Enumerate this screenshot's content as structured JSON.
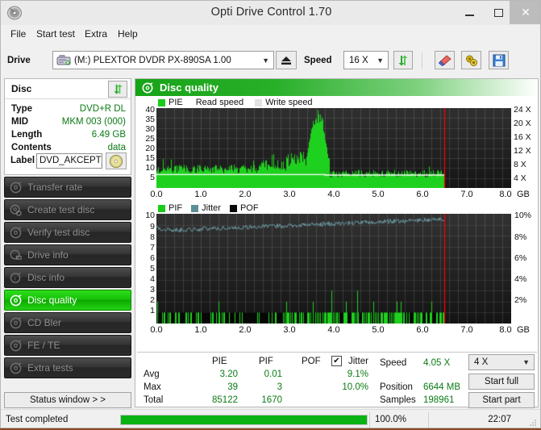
{
  "window": {
    "title": "Opti Drive Control 1.70",
    "icon": "disc-icon",
    "minimize": "–",
    "maximize": "□",
    "close": "✕"
  },
  "menu": {
    "items": [
      {
        "label": "File"
      },
      {
        "label": "Start test"
      },
      {
        "label": "Extra"
      },
      {
        "label": "Help"
      }
    ]
  },
  "toolbar": {
    "drive_label": "Drive",
    "drive_value": "(M:)   PLEXTOR DVDR   PX-890SA 1.00",
    "eject_icon": "eject-icon",
    "speed_label": "Speed",
    "speed_value": "16 X",
    "refresh_icon": "refresh-icon",
    "erase_icon": "eraser-icon",
    "settings_icon": "gear-icon",
    "save_icon": "save-icon"
  },
  "disc_panel": {
    "title": "Disc",
    "refresh_icon": "refresh-icon",
    "rows": [
      {
        "key": "Type",
        "value": "DVD+R DL"
      },
      {
        "key": "MID",
        "value": "MKM 003 (000)"
      },
      {
        "key": "Length",
        "value": "6.49 GB"
      },
      {
        "key": "Contents",
        "value": "data"
      }
    ],
    "label_key": "Label",
    "label_value": "DVD_AKCEPT_V",
    "label_icon": "cd-icon"
  },
  "sidebar": {
    "items": [
      {
        "label": "Transfer rate",
        "icon": "disc-test-icon",
        "active": false
      },
      {
        "label": "Create test disc",
        "icon": "disc-burn-icon",
        "active": false
      },
      {
        "label": "Verify test disc",
        "icon": "disc-verify-icon",
        "active": false
      },
      {
        "label": "Drive info",
        "icon": "drive-info-icon",
        "active": false
      },
      {
        "label": "Disc info",
        "icon": "disc-info-icon",
        "active": false
      },
      {
        "label": "Disc quality",
        "icon": "disc-quality-icon",
        "active": true
      },
      {
        "label": "CD Bler",
        "icon": "cd-bler-icon",
        "active": false
      },
      {
        "label": "FE / TE",
        "icon": "fe-te-icon",
        "active": false
      },
      {
        "label": "Extra tests",
        "icon": "extra-tests-icon",
        "active": false
      }
    ],
    "status_window_button": "Status window > >"
  },
  "main": {
    "header_title": "Disc quality",
    "header_icon": "disc-quality-icon"
  },
  "chart_data": [
    {
      "type": "bar",
      "name": "pie-chart",
      "title": "PIE",
      "legend": [
        {
          "label": "PIE",
          "color": "#19cc19",
          "swatch": true
        },
        {
          "label": "Read speed",
          "color": "#ffffff",
          "swatch": false
        },
        {
          "label": "Write speed",
          "color": "#dcdcdc",
          "swatch": true
        }
      ],
      "xlabel": "GB",
      "xticks": [
        "0.0",
        "1.0",
        "2.0",
        "3.0",
        "4.0",
        "5.0",
        "6.0",
        "7.0",
        "8.0"
      ],
      "xlim": [
        0,
        8
      ],
      "yticks_left": [
        "40",
        "35",
        "30",
        "25",
        "20",
        "15",
        "10",
        "5"
      ],
      "ylim_left": [
        0,
        41
      ],
      "yticks_right": [
        "24 X",
        "20 X",
        "16 X",
        "12 X",
        "8 X",
        "4 X"
      ],
      "ylim_right": [
        0,
        25
      ],
      "read_speed_line": 4.1,
      "data_end_x": 6.49,
      "cursor_x": 6.49,
      "grid": true,
      "bg": "#1b1b1b",
      "bar_color": "#1fd11f",
      "speed_line_color": "#ffffff",
      "cursor_color": "#ff0000"
    },
    {
      "type": "bar",
      "name": "pif-chart",
      "title": "PIF",
      "legend": [
        {
          "label": "PIF",
          "color": "#19cc19",
          "swatch": true
        },
        {
          "label": "Jitter",
          "color": "#5d8f96",
          "swatch": true
        },
        {
          "label": "POF",
          "color": "#000000",
          "swatch": true
        }
      ],
      "xlabel": "GB",
      "xticks": [
        "0.0",
        "1.0",
        "2.0",
        "3.0",
        "4.0",
        "5.0",
        "6.0",
        "7.0",
        "8.0"
      ],
      "xlim": [
        0,
        8
      ],
      "yticks_left": [
        "10",
        "9",
        "8",
        "7",
        "6",
        "5",
        "4",
        "3",
        "2",
        "1"
      ],
      "ylim_left": [
        0,
        10
      ],
      "yticks_right": [
        "10%",
        "8%",
        "6%",
        "4%",
        "2%"
      ],
      "ylim_right": [
        0,
        10
      ],
      "jitter_avg_pct": 9.1,
      "jitter_max_pct": 10.0,
      "data_end_x": 6.49,
      "cursor_x": 6.49,
      "grid": true,
      "bg": "#1b1b1b",
      "bar_color": "#1fd11f",
      "jitter_color": "#6b9aa2",
      "cursor_color": "#ff0000"
    }
  ],
  "stats": {
    "columns": [
      "PIE",
      "PIF",
      "POF",
      "Jitter"
    ],
    "jitter_checkbox": {
      "label": "Jitter",
      "checked": true,
      "mark": "✔"
    },
    "rows": [
      {
        "label": "Avg",
        "pie": "3.20",
        "pif": "0.01",
        "pof": "",
        "jitter": "9.1%"
      },
      {
        "label": "Max",
        "pie": "39",
        "pif": "3",
        "pof": "",
        "jitter": "10.0%"
      },
      {
        "label": "Total",
        "pie": "85122",
        "pif": "1670",
        "pof": "",
        "jitter": ""
      }
    ],
    "right": [
      {
        "label": "Speed",
        "value": "4.05 X"
      },
      {
        "label": "Position",
        "value": "6644 MB"
      },
      {
        "label": "Samples",
        "value": "198961"
      }
    ],
    "speed_select": "4 X",
    "start_full_button": "Start full",
    "start_part_button": "Start part"
  },
  "statusbar": {
    "message": "Test completed",
    "progress_percent": "100.0%",
    "progress_value": 100,
    "time": "22:07"
  },
  "colors": {
    "accent_green": "#19cc19",
    "header_green": "#17a317",
    "value_green": "#0b7a14",
    "cursor_red": "#ff0000",
    "plot_bg": "#1b1b1b"
  }
}
